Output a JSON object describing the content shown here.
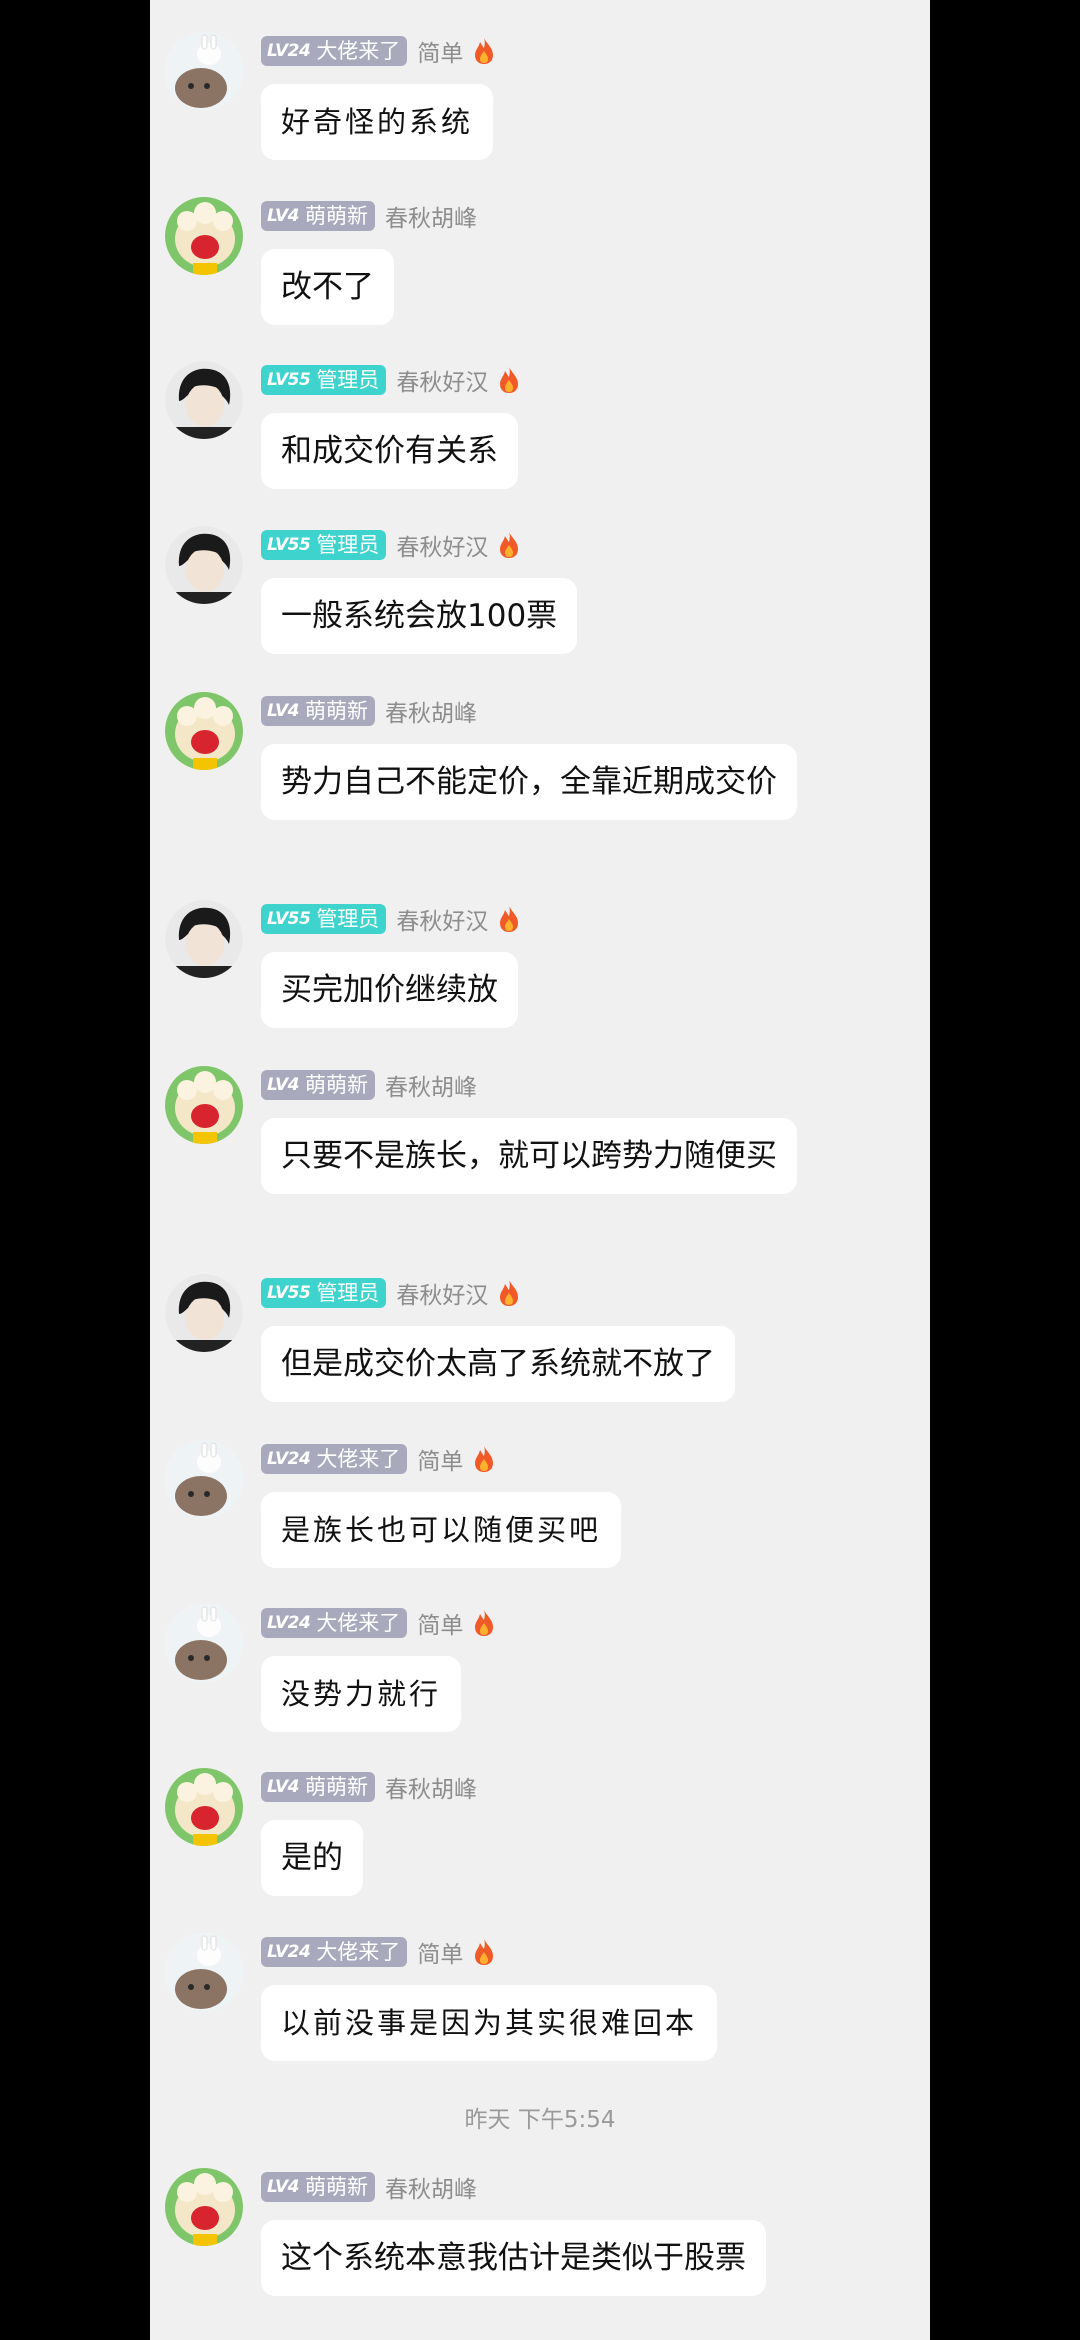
{
  "users": {
    "dalao": {
      "level": "LV24",
      "badge_text": "大佬来了",
      "name": "简单"
    },
    "mengxin": {
      "level": "LV4",
      "badge_text": "萌萌新",
      "name": "春秋胡峰"
    },
    "admin": {
      "level": "LV55",
      "badge_text": "管理员",
      "name": "春秋好汉"
    }
  },
  "messages": [
    {
      "text": "好奇怪的系统"
    },
    {
      "text": "改不了"
    },
    {
      "text": "和成交价有关系"
    },
    {
      "text": "一般系统会放100票"
    },
    {
      "text": "势力自己不能定价，全靠近期成交价"
    },
    {
      "text": "买完加价继续放"
    },
    {
      "text": "只要不是族长，就可以跨势力随便买"
    },
    {
      "text": "但是成交价太高了系统就不放了"
    },
    {
      "text": "是族长也可以随便买吧"
    },
    {
      "text": "没势力就行"
    },
    {
      "text": "是的"
    },
    {
      "text": "以前没事是因为其实很难回本"
    },
    {
      "text": "这个系统本意我估计是类似于股票"
    }
  ],
  "timestamp": "昨天 下午5:54",
  "colors": {
    "badge_grey": "#a8a9bd",
    "badge_admin": "#3fd3cd",
    "background": "#f0f0f0"
  }
}
